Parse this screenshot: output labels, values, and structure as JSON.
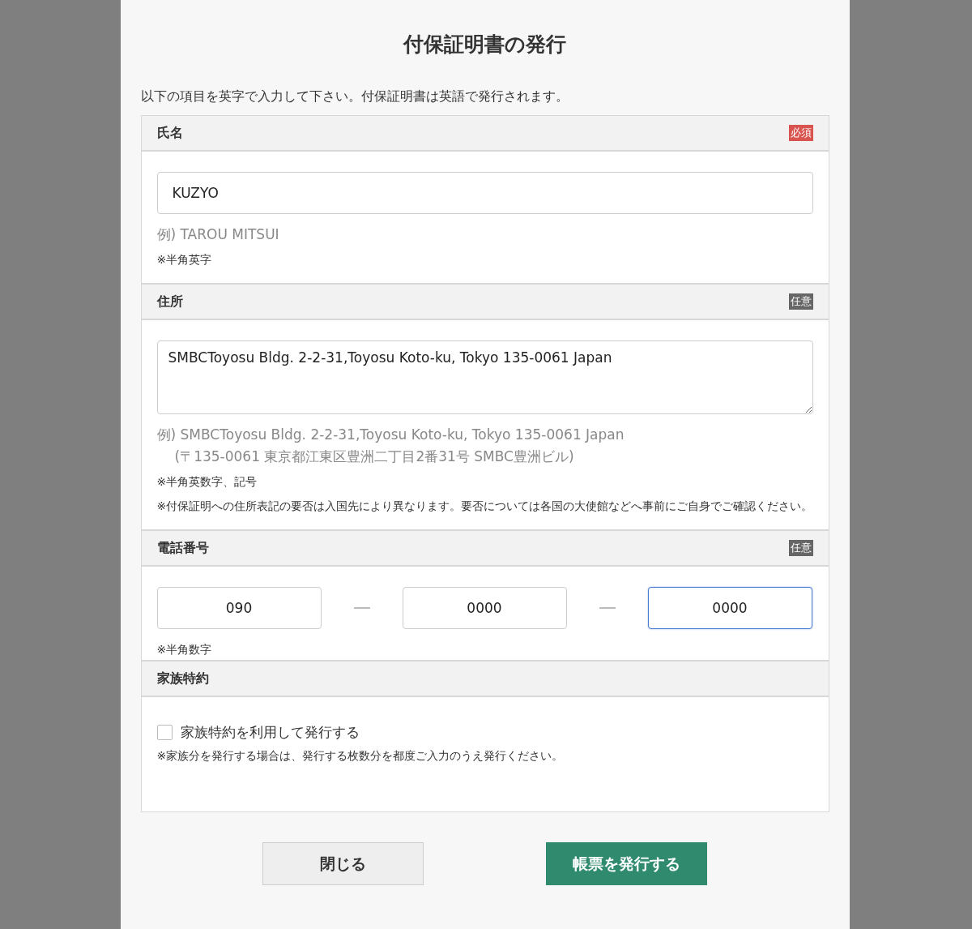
{
  "dialog": {
    "title": "付保証明書の発行",
    "intro": "以下の項目を英字で入力して下さい。付保証明書は英語で発行されます。"
  },
  "sections": [
    {
      "kind": "text",
      "label": "氏名",
      "badge": {
        "text": "必須",
        "required": true
      },
      "value": "KUZYO",
      "example": [
        "例) TAROU MITSUI"
      ],
      "notes": [
        "※半角英字"
      ]
    },
    {
      "kind": "textarea",
      "label": "住所",
      "badge": {
        "text": "任意",
        "required": false
      },
      "value": "SMBCToyosu Bldg. 2-2-31,Toyosu Koto-ku, Tokyo 135-0061 Japan",
      "example": [
        "例) SMBCToyosu Bldg. 2-2-31,Toyosu Koto-ku, Tokyo 135-0061 Japan",
        "(〒135-0061 東京都江東区豊洲二丁目2番31号 SMBC豊洲ビル)"
      ],
      "notes": [
        "※半角英数字、記号",
        "※付保証明への住所表記の要否は入国先により異なります。要否については各国の大使館などへ事前にご自身でご確認ください。"
      ]
    },
    {
      "kind": "phone",
      "label": "電話番号",
      "badge": {
        "text": "任意",
        "required": false
      },
      "parts": [
        {
          "value": "090",
          "focused": false
        },
        {
          "value": "0000",
          "focused": false
        },
        {
          "value": "0000",
          "focused": true
        }
      ],
      "notes": [
        "※半角数字"
      ]
    },
    {
      "kind": "checkbox",
      "label": "家族特約",
      "checkbox": {
        "label": "家族特約を利用して発行する",
        "checked": false
      },
      "notes": [
        "※家族分を発行する場合は、発行する枚数分を都度ご入力のうえ発行ください。"
      ]
    }
  ],
  "buttons": [
    {
      "label": "閉じる",
      "kind": "secondary"
    },
    {
      "label": "帳票を発行する",
      "kind": "primary"
    }
  ]
}
